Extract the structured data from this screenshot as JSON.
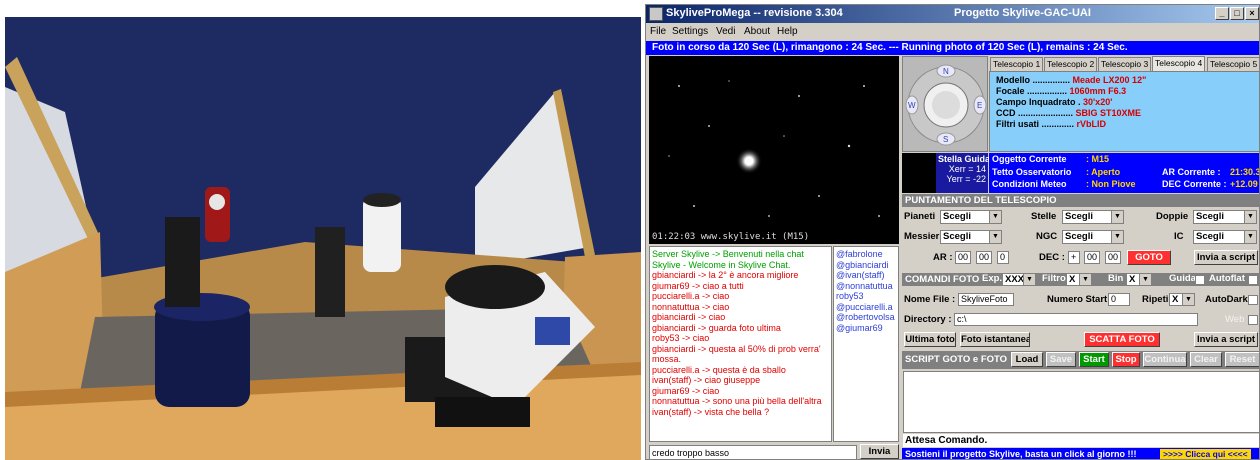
{
  "app": {
    "title": "SkyliveProMega -- revisione 3.304",
    "center_title": "Progetto Skylive-GAC-UAI",
    "window_buttons": [
      "_",
      "□",
      "×"
    ],
    "menu": [
      "File",
      "Settings",
      "Vedi",
      "About",
      "Help"
    ],
    "status": "Foto in corso da 120 Sec (L), rimangono : 24 Sec. --- Running photo of 120 Sec (L), remains : 24 Sec."
  },
  "image": {
    "caption": "01:22:03 www.skylive.it (M15)"
  },
  "compass": {
    "n": "N",
    "s": "S",
    "w": "W",
    "e": "E"
  },
  "tabs": [
    "Telescopio 1",
    "Telescopio 2",
    "Telescopio 3",
    "Telescopio 4",
    "Telescopio 5"
  ],
  "active_tab": "Telescopio 4",
  "telescope_info": [
    {
      "key": "Modello ...............",
      "value": "Meade LX200 12\""
    },
    {
      "key": "Focale ................",
      "value": "1060mm F6.3"
    },
    {
      "key": "Campo Inquadrato .",
      "value": "30'x20'"
    },
    {
      "key": "CCD ......................",
      "value": "SBIG ST10XME"
    },
    {
      "key": "Filtri usati .............",
      "value": "rVbLID"
    }
  ],
  "guide": {
    "title": "Stella Guida",
    "xerr": "Xerr = 14",
    "yerr": "Yerr = -22"
  },
  "object_panel": [
    {
      "k": "Oggetto Corrente",
      "v": ": M15",
      "k3": "",
      "v3": ""
    },
    {
      "k": "Tetto Osservatorio",
      "v": ": Aperto",
      "k3": "AR Corrente  :",
      "v3": "21:30.3"
    },
    {
      "k": "Condizioni Meteo",
      "v": ": Non Piove",
      "k3": "DEC Corrente :",
      "v3": "+12.09"
    }
  ],
  "pointing": {
    "header": "PUNTAMENTO DEL TELESCOPIO",
    "pianeti": "Pianeti",
    "stelle": "Stelle",
    "doppie": "Doppie",
    "messier": "Messier",
    "ngc": "NGC",
    "ic": "IC",
    "select_value": "Scegli",
    "ar_label": "AR :",
    "ar": [
      "00",
      "00",
      "0"
    ],
    "dec_label": "DEC :",
    "dec": [
      "+",
      "00",
      "00"
    ],
    "goto": "GOTO",
    "send_script": "Invia a script"
  },
  "photo_cmd": {
    "header": "COMANDI FOTO",
    "exp_label": "Exp.",
    "exp_value": "XXX",
    "filtro_label": "Filtro",
    "filtro_value": "X",
    "bin_label": "Bin",
    "bin_value": "X",
    "guida": "Guida",
    "autoflat": "Autoflat",
    "nome_file_label": "Nome File :",
    "nome_file": "SkyliveFoto",
    "numero_start_label": "Numero Start",
    "numero_start": "0",
    "ripeti_label": "Ripeti",
    "ripeti_value": "X",
    "autodark": "AutoDark",
    "directory_label": "Directory :",
    "directory": "c:\\",
    "web": "Web",
    "ultima_foto": "Ultima foto",
    "foto_istantanea": "Foto istantanea",
    "scatta_foto": "SCATTA FOTO",
    "send_script": "Invia a script"
  },
  "script": {
    "header": "SCRIPT GOTO e FOTO",
    "load": "Load",
    "save": "Save",
    "start": "Start",
    "stop": "Stop",
    "continua": "Continua",
    "clear": "Clear",
    "reset": "Reset",
    "status": "Attesa Comando."
  },
  "footer": {
    "text": "Sostieni il progetto Skylive, basta un click al giorno !!!",
    "cta": ">>>> Clicca qui <<<<"
  },
  "chat": {
    "messages": [
      {
        "text": "Server Skylive -> Benvenuti nella chat Skylive - Welcome in Skylive Chat.",
        "color": "#00a000"
      },
      {
        "text": "gbianciardi -> la 2° è ancora migliore",
        "color": "#e00000"
      },
      {
        "text": "giumar69 -> ciao a tutti",
        "color": "#e00000"
      },
      {
        "text": "pucciarelli.a -> ciao",
        "color": "#e00000"
      },
      {
        "text": "nonnatuttua -> ciao",
        "color": "#e00000"
      },
      {
        "text": "gbianciardi -> ciao",
        "color": "#e00000"
      },
      {
        "text": "gbianciardi -> guarda foto ultima",
        "color": "#e00000"
      },
      {
        "text": "roby53 -> ciao",
        "color": "#e00000"
      },
      {
        "text": "gbianciardi -> questa al 50% di prob verra' mossa.",
        "color": "#e00000"
      },
      {
        "text": "pucciarelli.a -> questa è da sballo",
        "color": "#e00000"
      },
      {
        "text": "ivan(staff) -> ciao giuseppe",
        "color": "#e00000"
      },
      {
        "text": "giumar69 -> ciao",
        "color": "#e00000"
      },
      {
        "text": "nonnatuttua -> sono una più bella dell'altra",
        "color": "#e00000"
      },
      {
        "text": "ivan(staff) -> vista che bella ?",
        "color": "#e00000"
      }
    ],
    "users": [
      "@fabrolone",
      "@gbianciardi",
      "@ivan(staff)",
      "@nonnatuttua",
      "roby53",
      "@pucciarelli.a",
      "@robertovolsa",
      "@giumar69"
    ],
    "input_value": "credo troppo basso",
    "send": "Invia"
  }
}
